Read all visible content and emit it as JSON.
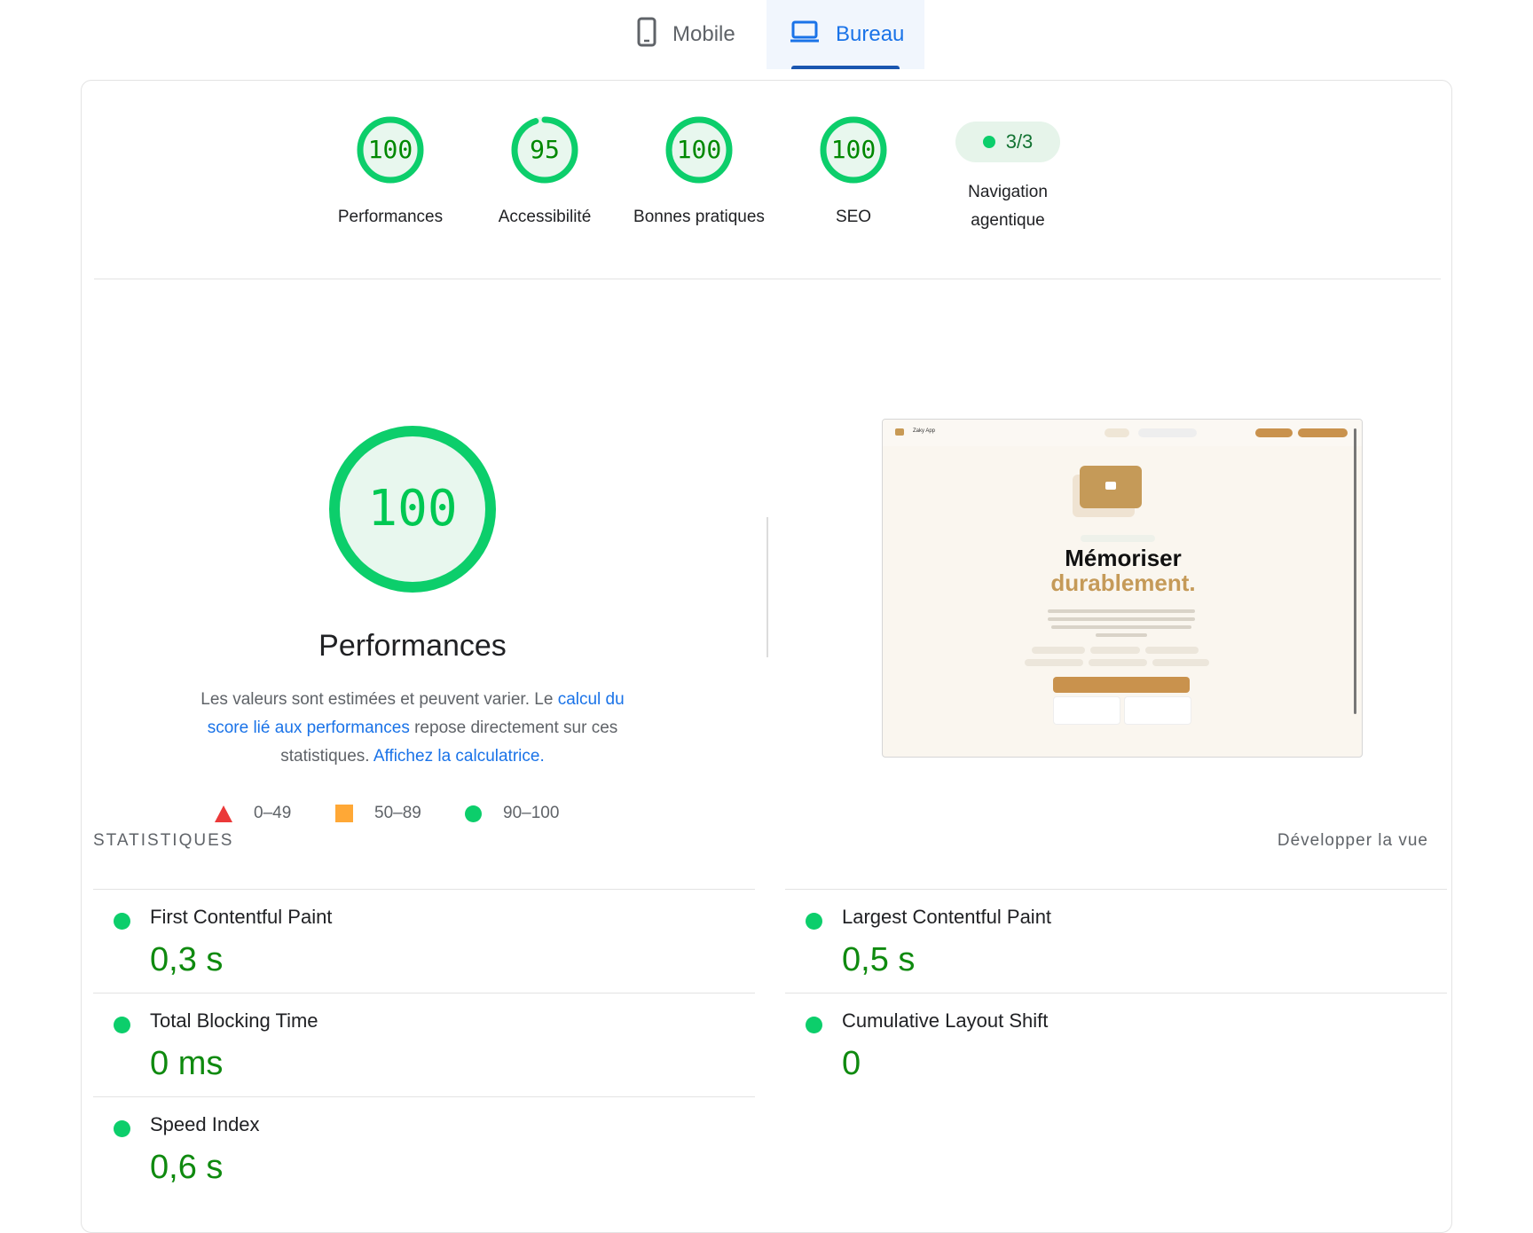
{
  "tabs": {
    "mobile": "Mobile",
    "desktop": "Bureau"
  },
  "summary": [
    {
      "score": "100",
      "label": "Performances",
      "progress": 1.0
    },
    {
      "score": "95",
      "label": "Accessibilité",
      "progress": 0.95
    },
    {
      "score": "100",
      "label": "Bonnes pratiques",
      "progress": 1.0
    },
    {
      "score": "100",
      "label": "SEO",
      "progress": 1.0
    }
  ],
  "agentic": {
    "value": "3/3",
    "label_line1": "Navigation",
    "label_line2": "agentique"
  },
  "performance": {
    "score": "100",
    "title": "Performances",
    "desc_1": "Les valeurs sont estimées et peuvent varier. Le ",
    "link_1": "calcul du score lié aux performances",
    "desc_2": " repose directement sur ces statistiques. ",
    "link_2": "Affichez la calculatrice."
  },
  "legend": {
    "low": "0–49",
    "mid": "50–89",
    "high": "90–100"
  },
  "thumbnail": {
    "app_name": "Zaky App",
    "heading_line1": "Mémoriser",
    "heading_line2": "durablement."
  },
  "stats": {
    "title": "STATISTIQUES",
    "expand": "Développer la vue",
    "metrics": [
      {
        "name": "First Contentful Paint",
        "value": "0,3 s"
      },
      {
        "name": "Largest Contentful Paint",
        "value": "0,5 s"
      },
      {
        "name": "Total Blocking Time",
        "value": "0 ms"
      },
      {
        "name": "Cumulative Layout Shift",
        "value": "0"
      },
      {
        "name": "Speed Index",
        "value": "0,6 s"
      }
    ]
  },
  "colors": {
    "pass": "#0cce6b",
    "average": "#ffa836",
    "fail": "#eb3939",
    "link": "#1a73e8",
    "accent": "#c59a58"
  }
}
